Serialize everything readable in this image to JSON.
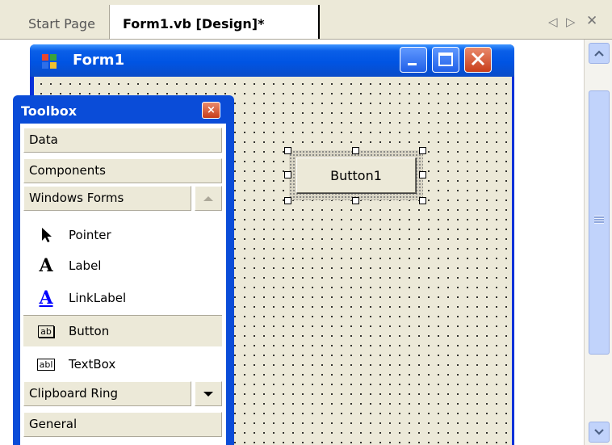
{
  "tabs": {
    "start_page": "Start Page",
    "active": "Form1.vb [Design]*"
  },
  "tab_controls": {
    "prev": "◁",
    "next": "▷",
    "close": "✕"
  },
  "form": {
    "title": "Form1",
    "button_label": "Button1"
  },
  "toolbox": {
    "title": "Toolbox",
    "close_glyph": "×",
    "tabs": {
      "data": "Data",
      "components": "Components",
      "windows_forms": "Windows Forms",
      "clipboard_ring": "Clipboard Ring",
      "general": "General"
    },
    "items": [
      {
        "label": "Pointer",
        "icon": "pointer-arrow-icon"
      },
      {
        "label": "Label",
        "icon": "label-a-icon"
      },
      {
        "label": "LinkLabel",
        "icon": "link-label-a-icon"
      },
      {
        "label": "Button",
        "icon": "button-ab-icon"
      },
      {
        "label": "TextBox",
        "icon": "textbox-abl-icon"
      }
    ],
    "selected_item": "Button"
  },
  "colors": {
    "xp_blue": "#0054e3",
    "face": "#ece9d8",
    "link_blue": "#0000ff",
    "close_red": "#c83d1a"
  }
}
